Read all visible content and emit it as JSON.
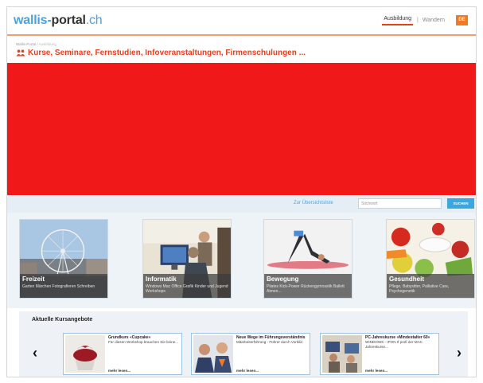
{
  "header": {
    "logo": {
      "part1": "wallis-",
      "part2": "portal",
      "part3": ".ch"
    },
    "nav": [
      {
        "label": "Ausbildung",
        "active": true
      },
      {
        "label": "Wandern",
        "active": false
      }
    ],
    "nav_separator": "|",
    "language": "DE"
  },
  "breadcrumb": {
    "home": "Wallis-Portal",
    "separator": " / ",
    "current": "Ausbildung"
  },
  "page_title": "Kurse, Seminare, Fernstudien, Infoveranstaltungen, Firmenschulungen ...",
  "search": {
    "overview_link": "Zur Übersichtsliste",
    "placeholder": "Stichwort",
    "button": "SUCHEN"
  },
  "categories": [
    {
      "title": "Freizeit",
      "subtitle": "Garten Märchen Fotografieren Schreiben",
      "icon": "ferris-wheel-photo"
    },
    {
      "title": "Informatik",
      "subtitle": "Windows Mac Office Grafik Kinder und Jugend Workshops",
      "icon": "computer-class-photo"
    },
    {
      "title": "Bewegung",
      "subtitle": "Pilates Kick-Power Rückengymnastik Ballett Atmen...",
      "icon": "yoga-photo"
    },
    {
      "title": "Gesundheit",
      "subtitle": "Pflege, Babysitter, Palliative Care, Psychogenetik",
      "icon": "healthy-food-photo"
    }
  ],
  "courses": {
    "heading": "Aktuelle Kursangebote",
    "items": [
      {
        "title": "Grundkurs «Cupcake»",
        "description": "Für diesen Workshop brauchen Sie keine...",
        "more": "mehr lesen..."
      },
      {
        "title": "Neue Wege im Führungsverständnis",
        "description": "Mitarbeiterführung - Führer durch Vorbild",
        "more": "mehr lesen..."
      },
      {
        "title": "PC-Jahreskurse «Mindestalter 60»",
        "description": "WINDOWS - IPON If profi der MAC Jahreskurse...",
        "more": "mehr lesen..."
      }
    ],
    "prev": "‹",
    "next": "›"
  },
  "colors": {
    "accent": "#e8401c",
    "banner": "#f01818",
    "link": "#4aa3df",
    "button": "#3aa7e0"
  }
}
